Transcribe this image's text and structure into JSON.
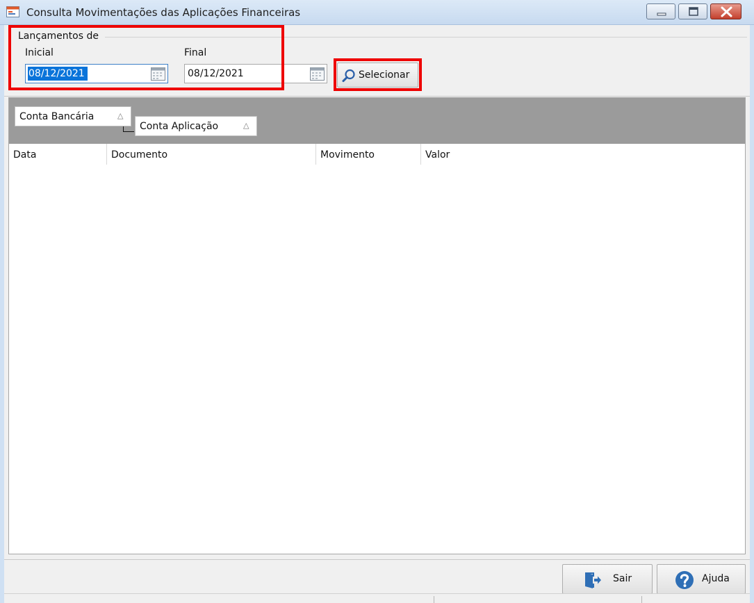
{
  "window": {
    "title": "Consulta Movimentações das Aplicações Financeiras",
    "minimize_icon": "minimize-icon",
    "maximize_icon": "maximize-icon",
    "close_icon": "close-icon"
  },
  "filter": {
    "group_label": "Lançamentos de",
    "initial_label": "Inicial",
    "initial_value": "08/12/2021",
    "final_label": "Final",
    "final_value": "08/12/2021",
    "calendar_icon": "calendar-icon",
    "select_button": "Selecionar",
    "select_icon": "search-icon"
  },
  "grid": {
    "group_by": [
      {
        "label": "Conta Bancária",
        "sort": "△"
      },
      {
        "label": "Conta Aplicação",
        "sort": "△"
      }
    ],
    "columns": [
      "Data",
      "Documento",
      "Movimento",
      "Valor"
    ],
    "rows": []
  },
  "footer": {
    "exit_button": "Sair",
    "exit_icon": "exit-door-icon",
    "help_button": "Ajuda",
    "help_icon": "help-icon"
  },
  "colors": {
    "highlight": "#ee0000",
    "selection": "#0a74da",
    "group_panel": "#9b9b9b"
  }
}
